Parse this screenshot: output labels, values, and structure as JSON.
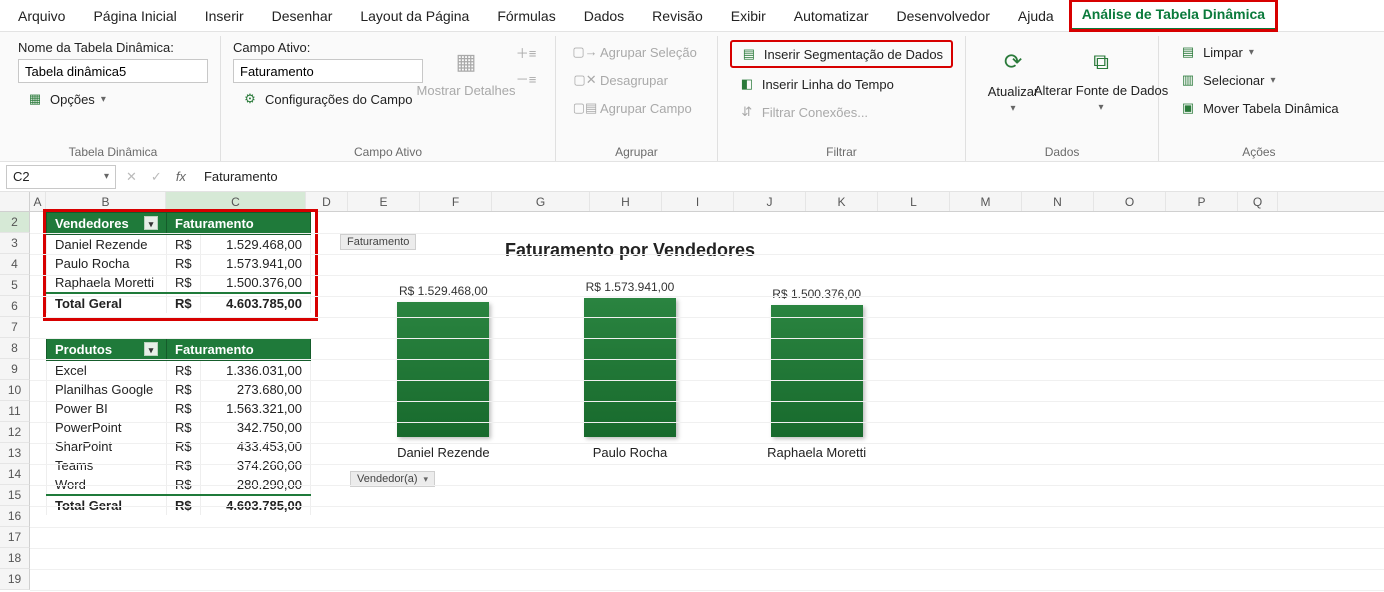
{
  "menu": {
    "items": [
      "Arquivo",
      "Página Inicial",
      "Inserir",
      "Desenhar",
      "Layout da Página",
      "Fórmulas",
      "Dados",
      "Revisão",
      "Exibir",
      "Automatizar",
      "Desenvolvedor",
      "Ajuda",
      "Análise de Tabela Dinâmica"
    ],
    "active_index": 12
  },
  "ribbon": {
    "pivot_group": {
      "title_label": "Nome da Tabela Dinâmica:",
      "name_value": "Tabela dinâmica5",
      "options_label": "Opções",
      "group_label": "Tabela Dinâmica"
    },
    "field_group": {
      "title_label": "Campo Ativo:",
      "field_value": "Faturamento",
      "settings_label": "Configurações do Campo",
      "show_details": "Mostrar Detalhes",
      "group_label": "Campo Ativo"
    },
    "agrupar": {
      "sel": "Agrupar Seleção",
      "des": "Desagrupar",
      "camp": "Agrupar Campo",
      "group_label": "Agrupar"
    },
    "filter": {
      "slicer": "Inserir Segmentação de Dados",
      "timeline": "Inserir Linha do Tempo",
      "conn": "Filtrar Conexões...",
      "group_label": "Filtrar"
    },
    "data": {
      "refresh": "Atualizar",
      "source": "Alterar Fonte de Dados",
      "group_label": "Dados"
    },
    "actions": {
      "clear": "Limpar",
      "select": "Selecionar",
      "move": "Mover Tabela Dinâmica",
      "group_label": "Ações"
    }
  },
  "formula": {
    "cell": "C2",
    "content": "Faturamento"
  },
  "columns": [
    "A",
    "B",
    "C",
    "D",
    "E",
    "F",
    "G",
    "H",
    "I",
    "J",
    "K",
    "L",
    "M",
    "N",
    "O",
    "P",
    "Q"
  ],
  "rows_count": 18,
  "pivot1": {
    "headers": [
      "Vendedores",
      "Faturamento"
    ],
    "currency": "R$",
    "rows": [
      {
        "name": "Daniel Rezende",
        "value": "1.529.468,00"
      },
      {
        "name": "Paulo Rocha",
        "value": "1.573.941,00"
      },
      {
        "name": "Raphaela Moretti",
        "value": "1.500.376,00"
      }
    ],
    "total_label": "Total Geral",
    "total_value": "4.603.785,00"
  },
  "pivot2": {
    "headers": [
      "Produtos",
      "Faturamento"
    ],
    "currency": "R$",
    "rows": [
      {
        "name": "Excel",
        "value": "1.336.031,00"
      },
      {
        "name": "Planilhas Google",
        "value": "273.680,00"
      },
      {
        "name": "Power BI",
        "value": "1.563.321,00"
      },
      {
        "name": "PowerPoint",
        "value": "342.750,00"
      },
      {
        "name": "SharPoint",
        "value": "433.453,00"
      },
      {
        "name": "Teams",
        "value": "374.260,00"
      },
      {
        "name": "Word",
        "value": "280.290,00"
      }
    ],
    "total_label": "Total Geral",
    "total_value": "4.603.785,00"
  },
  "chart_data": {
    "type": "bar",
    "title": "Faturamento por Vendedores",
    "value_field_pill": "Faturamento",
    "axis_field_pill": "Vendedor(a)",
    "currency_prefix": "R$ ",
    "categories": [
      "Daniel Rezende",
      "Paulo Rocha",
      "Raphaela Moretti"
    ],
    "values": [
      1529468.0,
      1573941.0,
      1500376.0
    ],
    "value_labels": [
      "1.529.468,00",
      "1.573.941,00",
      "1.500.376,00"
    ],
    "ylim": [
      0,
      1700000
    ]
  }
}
